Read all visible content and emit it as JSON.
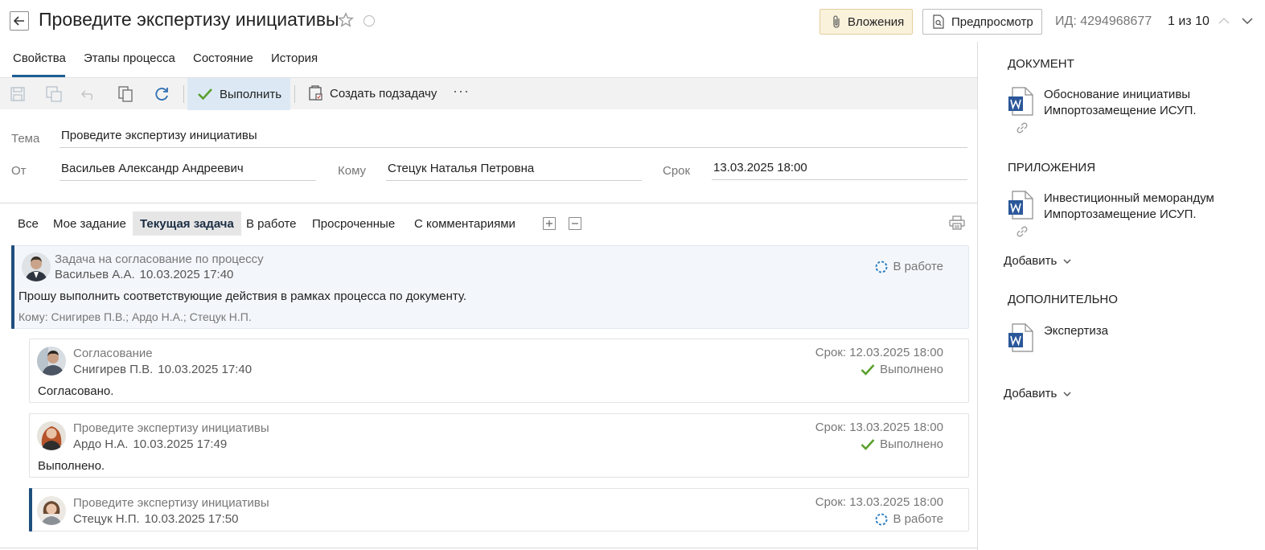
{
  "header": {
    "title": "Проведите экспертизу инициативы",
    "attachments_label": "Вложения",
    "preview_label": "Предпросмотр",
    "id_text": "ИД: 4294968677",
    "pager_text": "1 из 10"
  },
  "tabs": [
    {
      "label": "Свойства",
      "active": true
    },
    {
      "label": "Этапы процесса"
    },
    {
      "label": "Состояние"
    },
    {
      "label": "История"
    }
  ],
  "toolbar": {
    "execute_label": "Выполнить",
    "subtask_label": "Создать подзадачу",
    "more_label": "···"
  },
  "form": {
    "subject_label": "Тема",
    "subject_value": "Проведите экспертизу инициативы",
    "from_label": "От",
    "from_value": "Васильев Александр Андреевич",
    "to_label": "Кому",
    "to_value": "Стецук Наталья Петровна",
    "due_label": "Срок",
    "due_value": "13.03.2025 18:00"
  },
  "filters": [
    {
      "label": "Все"
    },
    {
      "label": "Мое задание"
    },
    {
      "label": "Текущая задача",
      "active": true
    },
    {
      "label": "В работе"
    },
    {
      "label": "Просроченные"
    },
    {
      "label": "С комментариями"
    }
  ],
  "tasks": [
    {
      "type": "Задача на согласование по процессу",
      "author": "Васильев А.А.",
      "datetime": "10.03.2025 17:40",
      "status": "В работе",
      "text": "Прошу выполнить соответствующие действия в рамках процесса по документу.",
      "to": "Кому: Снигирев П.В.; Ардо Н.А.; Стецук Н.П."
    },
    {
      "type": "Согласование",
      "author": "Снигирев П.В.",
      "datetime": "10.03.2025 17:40",
      "due": "Срок: 12.03.2025 18:00",
      "status": "Выполнено",
      "text": "Согласовано."
    },
    {
      "type": "Проведите экспертизу инициативы",
      "author": "Ардо Н.А.",
      "datetime": "10.03.2025 17:49",
      "due": "Срок: 13.03.2025 18:00",
      "status": "Выполнено",
      "text": "Выполнено."
    },
    {
      "type": "Проведите экспертизу инициативы",
      "author": "Стецук Н.П.",
      "datetime": "10.03.2025 17:50",
      "due": "Срок: 13.03.2025 18:00",
      "status": "В работе"
    }
  ],
  "right_panel": {
    "document_heading": "ДОКУМЕНТ",
    "document_name_line1": "Обоснование инициативы",
    "document_name_line2": "Импортозамещение ИСУП.",
    "attachments_heading": "ПРИЛОЖЕНИЯ",
    "attachment_name_line1": "Инвестиционный меморандум",
    "attachment_name_line2": "Импортозамещение ИСУП.",
    "add_label_1": "Добавить",
    "additional_heading": "ДОПОЛНИТЕЛЬНО",
    "additional_name": "Экспертиза",
    "add_label_2": "Добавить"
  },
  "colors": {
    "accent": "#1f4f7d",
    "done_green": "#5aa02c",
    "in_progress_blue": "#2f7fc1",
    "word_blue": "#2b579a",
    "attach_bg": "#fbf2dc"
  }
}
